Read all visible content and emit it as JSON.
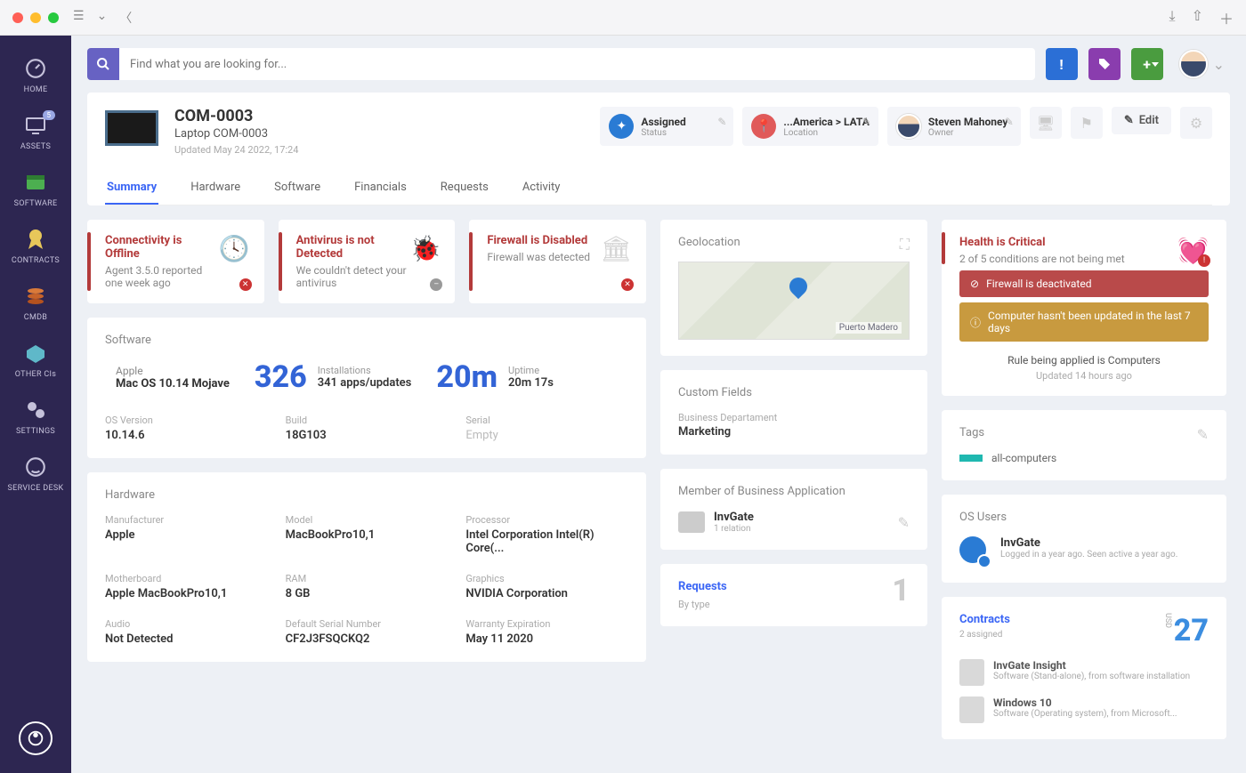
{
  "window": {
    "traffic": [
      "close",
      "minimize",
      "zoom"
    ]
  },
  "sidebar": {
    "items": [
      {
        "label": "HOME",
        "icon": "gauge"
      },
      {
        "label": "ASSETS",
        "icon": "monitor",
        "badge": "5"
      },
      {
        "label": "SOFTWARE",
        "icon": "window"
      },
      {
        "label": "CONTRACTS",
        "icon": "ribbon"
      },
      {
        "label": "CMDB",
        "icon": "stack"
      },
      {
        "label": "OTHER CIs",
        "icon": "box"
      },
      {
        "label": "SETTINGS",
        "icon": "gear"
      },
      {
        "label": "SERVICE DESK",
        "icon": "headset"
      }
    ]
  },
  "search": {
    "placeholder": "Find what you are looking for..."
  },
  "topbtns": {
    "info": "!",
    "tag": "🏷",
    "add": "+"
  },
  "asset": {
    "code": "COM-0003",
    "name": "Laptop COM-0003",
    "updated": "Updated May 24 2022, 17:24",
    "status": {
      "label": "Status",
      "value": "Assigned"
    },
    "location": {
      "label": "Location",
      "value": "...America > LATA"
    },
    "owner": {
      "label": "Owner",
      "value": "Steven Mahoney"
    },
    "edit": "Edit"
  },
  "tabs": [
    {
      "label": "Summary",
      "active": true
    },
    {
      "label": "Hardware"
    },
    {
      "label": "Software"
    },
    {
      "label": "Financials"
    },
    {
      "label": "Requests"
    },
    {
      "label": "Activity"
    }
  ],
  "alerts": [
    {
      "title": "Connectivity is Offline",
      "sub": "Agent 3.5.0 reported one week ago",
      "icon": "clock"
    },
    {
      "title": "Antivirus is not Detected",
      "sub": "We couldn't detect your antivirus",
      "icon": "bug"
    },
    {
      "title": "Firewall is Disabled",
      "sub": "Firewall was detected",
      "icon": "garage"
    }
  ],
  "software": {
    "heading": "Software",
    "vendor": "Apple",
    "os": "Mac OS 10.14 Mojave",
    "installs_num": "326",
    "installs_lbl": "Installations",
    "installs_sub": "341 apps/updates",
    "uptime_num": "20m",
    "uptime_lbl": "Uptime",
    "uptime_sub": "20m 17s",
    "details": [
      {
        "k": "OS Version",
        "v": "10.14.6"
      },
      {
        "k": "Build",
        "v": "18G103"
      },
      {
        "k": "Serial",
        "v": "Empty",
        "empty": true
      }
    ]
  },
  "hardware": {
    "heading": "Hardware",
    "items": [
      {
        "k": "Manufacturer",
        "v": "Apple"
      },
      {
        "k": "Model",
        "v": "MacBookPro10,1"
      },
      {
        "k": "Processor",
        "v": "Intel Corporation Intel(R) Core(..."
      },
      {
        "k": "Motherboard",
        "v": "Apple MacBookPro10,1"
      },
      {
        "k": "RAM",
        "v": "8 GB"
      },
      {
        "k": "Graphics",
        "v": "NVIDIA Corporation"
      },
      {
        "k": "Audio",
        "v": "Not Detected"
      },
      {
        "k": "Default Serial Number",
        "v": "CF2J3FSQCKQ2"
      },
      {
        "k": "Warranty Expiration",
        "v": "May 11 2020"
      }
    ]
  },
  "geo": {
    "heading": "Geolocation",
    "place": "Puerto Madero"
  },
  "custom": {
    "heading": "Custom Fields",
    "field": "Business Departament",
    "value": "Marketing"
  },
  "ba": {
    "heading": "Member of Business Application",
    "name": "InvGate",
    "rel": "1 relation"
  },
  "requests": {
    "title": "Requests",
    "sub": "By type",
    "count": "1"
  },
  "health": {
    "title": "Health is Critical",
    "sub": "2 of 5 conditions are not being met",
    "msgs": [
      {
        "text": "Firewall is deactivated",
        "cls": "hm-red"
      },
      {
        "text": "Computer hasn't been updated in the last 7 days",
        "cls": "hm-yel"
      }
    ],
    "rule": "Rule being applied is Computers",
    "updated": "Updated 14 hours ago"
  },
  "tags": {
    "heading": "Tags",
    "items": [
      {
        "color": "#1fb8b0",
        "label": "all-computers"
      }
    ]
  },
  "osusers": {
    "heading": "OS Users",
    "name": "InvGate",
    "meta": "Logged in a year ago. Seen active a year ago."
  },
  "contracts": {
    "heading": "Contracts",
    "assigned": "2 assigned",
    "currency": "USD",
    "amount": "27",
    "items": [
      {
        "name": "InvGate Insight",
        "meta": "Software (Stand-alone), from software installation"
      },
      {
        "name": "Windows 10",
        "meta": "Software (Operating system), from Microsoft..."
      }
    ]
  }
}
